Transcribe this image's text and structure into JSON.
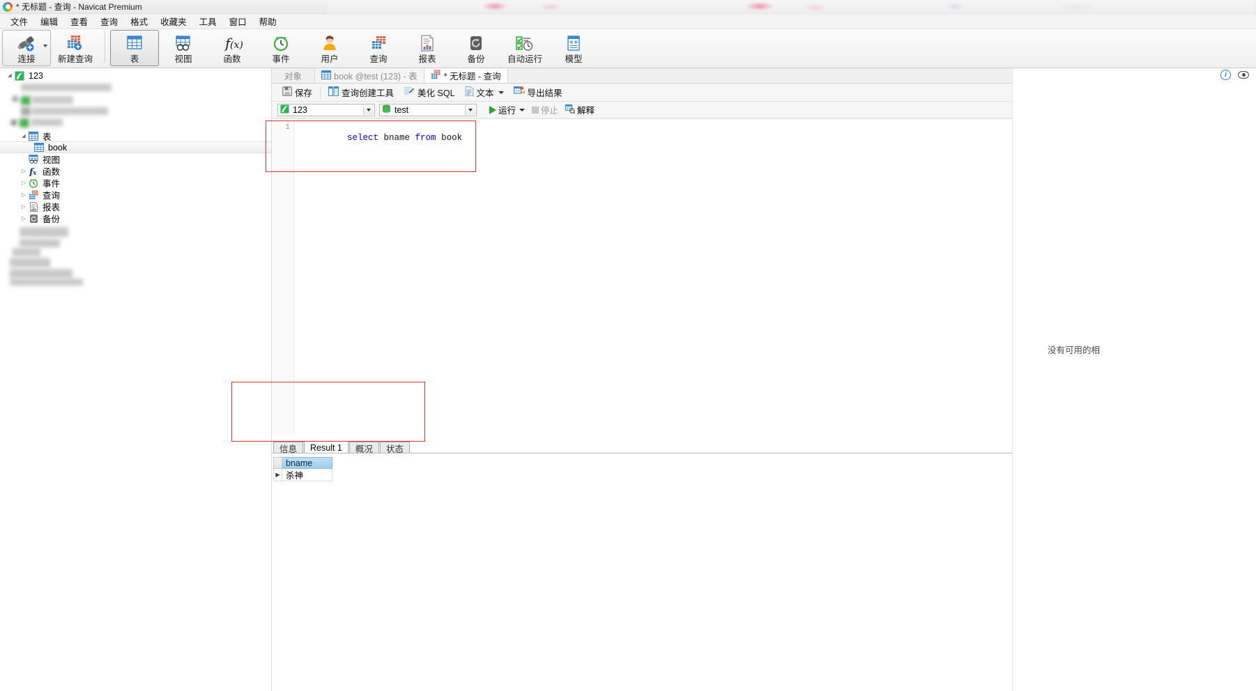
{
  "window": {
    "title": "* 无标题 - 查询 - Navicat Premium",
    "logo_icon": "navicat-logo-icon"
  },
  "menubar": {
    "items": [
      {
        "label": "文件",
        "name": "menu-file"
      },
      {
        "label": "编辑",
        "name": "menu-edit"
      },
      {
        "label": "查看",
        "name": "menu-view"
      },
      {
        "label": "查询",
        "name": "menu-query"
      },
      {
        "label": "格式",
        "name": "menu-format"
      },
      {
        "label": "收藏夹",
        "name": "menu-favorites"
      },
      {
        "label": "工具",
        "name": "menu-tools"
      },
      {
        "label": "窗口",
        "name": "menu-window"
      },
      {
        "label": "帮助",
        "name": "menu-help"
      }
    ]
  },
  "toolbar": {
    "buttons": [
      {
        "label": "连接",
        "icon": "connection-icon",
        "name": "toolbar-connection",
        "framed": true,
        "active": false,
        "dropdown": true
      },
      {
        "label": "新建查询",
        "icon": "new-query-icon",
        "name": "toolbar-new-query",
        "framed": false,
        "active": false,
        "dropdown": false
      },
      {
        "label": "表",
        "icon": "table-icon",
        "name": "toolbar-table",
        "framed": false,
        "active": true,
        "dropdown": false
      },
      {
        "label": "视图",
        "icon": "view-icon",
        "name": "toolbar-view",
        "framed": false,
        "active": false,
        "dropdown": false
      },
      {
        "label": "函数",
        "icon": "function-icon",
        "name": "toolbar-function",
        "framed": false,
        "active": false,
        "dropdown": false
      },
      {
        "label": "事件",
        "icon": "event-clock-icon",
        "name": "toolbar-event",
        "framed": false,
        "active": false,
        "dropdown": false
      },
      {
        "label": "用户",
        "icon": "user-icon",
        "name": "toolbar-user",
        "framed": false,
        "active": false,
        "dropdown": false
      },
      {
        "label": "查询",
        "icon": "query-icon",
        "name": "toolbar-query",
        "framed": false,
        "active": false,
        "dropdown": false
      },
      {
        "label": "报表",
        "icon": "report-icon",
        "name": "toolbar-report",
        "framed": false,
        "active": false,
        "dropdown": false
      },
      {
        "label": "备份",
        "icon": "backup-icon",
        "name": "toolbar-backup",
        "framed": false,
        "active": false,
        "dropdown": false
      },
      {
        "label": "自动运行",
        "icon": "automation-icon",
        "name": "toolbar-automation",
        "framed": false,
        "active": false,
        "dropdown": false
      },
      {
        "label": "模型",
        "icon": "model-icon",
        "name": "toolbar-model",
        "framed": false,
        "active": false,
        "dropdown": false
      }
    ]
  },
  "tree": {
    "root": {
      "label": "123",
      "icon": "connection-node-icon",
      "expanded": true
    },
    "items": [
      {
        "label": "表",
        "icon": "table-icon",
        "name": "tree-item-tables",
        "indent": 3,
        "twist": "open",
        "selected": false
      },
      {
        "label": "book",
        "icon": "table-icon",
        "name": "tree-item-book",
        "indent": 4,
        "twist": "none",
        "selected": true
      },
      {
        "label": "视图",
        "icon": "view-icon",
        "name": "tree-item-views",
        "indent": 3,
        "twist": "none",
        "selected": false
      },
      {
        "label": "函数",
        "icon": "function-icon",
        "name": "tree-item-functions",
        "indent": 3,
        "twist": "closed",
        "selected": false
      },
      {
        "label": "事件",
        "icon": "event-clock-icon",
        "name": "tree-item-events",
        "indent": 3,
        "twist": "closed",
        "selected": false
      },
      {
        "label": "查询",
        "icon": "query-icon",
        "name": "tree-item-queries",
        "indent": 3,
        "twist": "closed",
        "selected": false
      },
      {
        "label": "报表",
        "icon": "report-icon",
        "name": "tree-item-reports",
        "indent": 3,
        "twist": "closed",
        "selected": false
      },
      {
        "label": "备份",
        "icon": "backup-icon",
        "name": "tree-item-backups",
        "indent": 3,
        "twist": "closed",
        "selected": false
      }
    ]
  },
  "tabs": {
    "objects_label": "对象",
    "documents": [
      {
        "label": "book @test (123) - 表",
        "icon": "table-icon",
        "active": false,
        "name": "doc-tab-book"
      },
      {
        "label": "* 无标题 - 查询",
        "icon": "query-icon",
        "active": true,
        "name": "doc-tab-query"
      }
    ]
  },
  "query_toolbar": {
    "save": "保存",
    "query_builder": "查询创建工具",
    "beautify_sql": "美化 SQL",
    "text": "文本",
    "export_result": "导出结果",
    "icons": {
      "save": "save-disk-icon",
      "query_builder": "query-builder-icon",
      "beautify": "beautify-sql-icon",
      "text": "text-document-icon",
      "export": "export-result-icon"
    }
  },
  "query_bar": {
    "connection_value": "123",
    "connection_icon": "connection-node-icon",
    "database_value": "test",
    "database_icon": "database-icon",
    "run_label": "运行",
    "stop_label": "停止",
    "explain_label": "解释",
    "run_icon": "play-icon",
    "stop_icon": "stop-icon",
    "explain_icon": "explain-icon"
  },
  "sql_editor": {
    "line_numbers": [
      "1"
    ],
    "sql_tokens": [
      {
        "text": "select ",
        "type": "keyword"
      },
      {
        "text": "bname ",
        "type": "identifier"
      },
      {
        "text": "from ",
        "type": "keyword"
      },
      {
        "text": "book",
        "type": "identifier"
      }
    ],
    "full_sql": "select bname from book"
  },
  "result_panel": {
    "tabs": [
      {
        "label": "信息",
        "active": false,
        "name": "result-tab-info"
      },
      {
        "label": "Result 1",
        "active": true,
        "name": "result-tab-result1"
      },
      {
        "label": "概况",
        "active": false,
        "name": "result-tab-profile"
      },
      {
        "label": "状态",
        "active": false,
        "name": "result-tab-status"
      }
    ],
    "grid": {
      "columns": [
        "bname"
      ],
      "rows": [
        [
          "杀神"
        ]
      ]
    }
  },
  "right_panel": {
    "note": "没有可用的相",
    "icons": [
      "info-circle-icon",
      "eye-icon"
    ]
  }
}
